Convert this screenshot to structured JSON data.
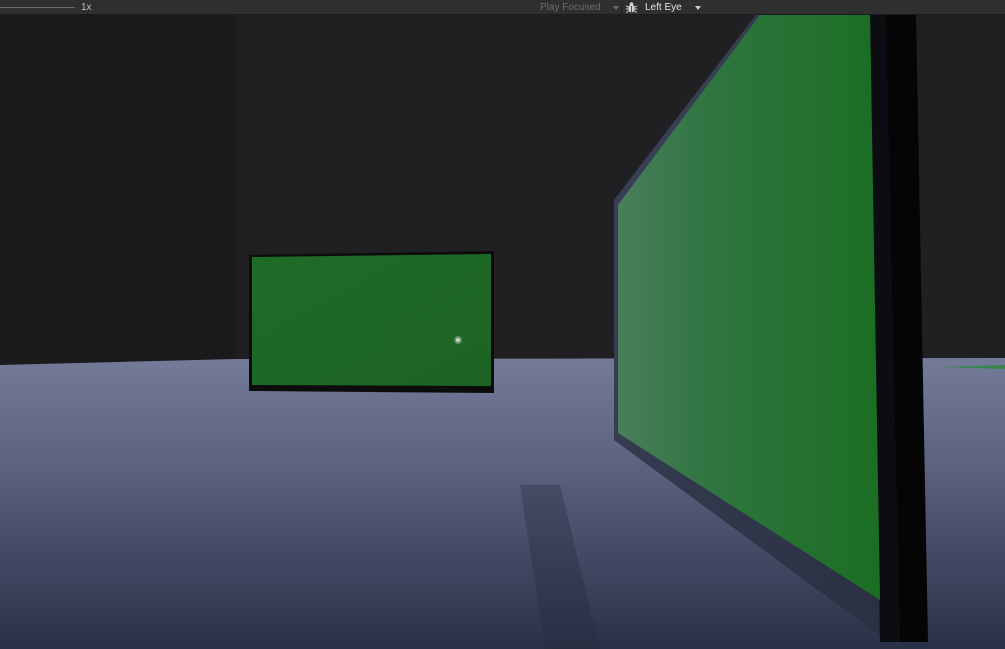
{
  "toolbar": {
    "scale_label": "1x",
    "play_mode_label": "Play Focused",
    "view_label": "Left Eye",
    "debug_icon": "bug-icon",
    "dropdown_icon": "caret-down-icon"
  },
  "scene": {
    "wall_color": "#202023",
    "floor_color": "#6d7594",
    "panel_color": "#1f6a26"
  }
}
